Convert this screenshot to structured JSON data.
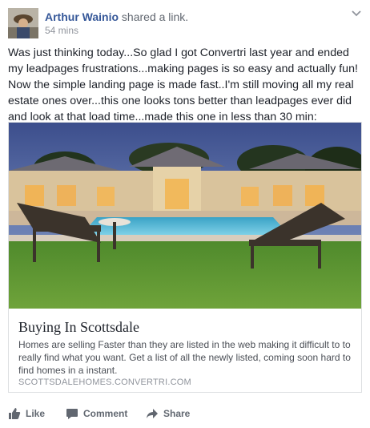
{
  "post": {
    "author": "Arthur Wainio",
    "action_text": "shared a link.",
    "time": "54 mins",
    "message": "Was just thinking today...So glad I got Convertri last year and ended my leadpages frustrations...making pages is so easy and actually fun! Now the simple landing page is made fast..I'm still moving all my real estate ones over...this one looks tons better than leadpages ever did and look at that load time...made this one in less than 30 min:",
    "icons": [
      "profile-avatar",
      "chevron-down-icon",
      "like-icon",
      "comment-icon",
      "share-icon"
    ]
  },
  "link_card": {
    "title": "Buying In Scottsdale",
    "description": "Homes are selling Faster than they are listed in the web making it difficult to to really find what you want. Get a list of all the newly listed, coming soon hard to find homes in a instant.",
    "domain": "SCOTTSDALEHOMES.CONVERTRI.COM"
  },
  "actions": {
    "like": "Like",
    "comment": "Comment",
    "share": "Share"
  },
  "colors": {
    "author_link": "#365899",
    "text": "#1d2129",
    "muted": "#90949c",
    "action": "#616770",
    "border": "#dddfe2"
  }
}
